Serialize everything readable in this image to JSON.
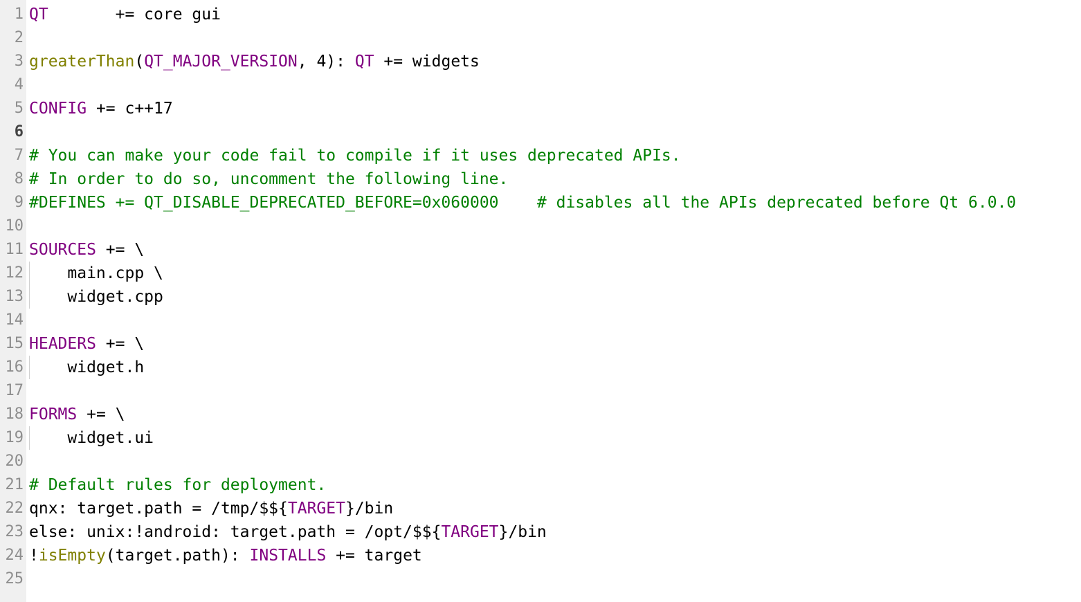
{
  "colors": {
    "variable": "#800080",
    "function": "#808000",
    "comment": "#008000",
    "plain": "#000000",
    "gutter_bg": "#f0f0f0",
    "line_number": "#8e8e8e"
  },
  "current_line": 6,
  "lines": [
    {
      "n": "1",
      "tokens": [
        {
          "t": "var",
          "v": "QT"
        },
        {
          "t": "plain",
          "v": "       += core gui"
        }
      ]
    },
    {
      "n": "2",
      "tokens": []
    },
    {
      "n": "3",
      "tokens": [
        {
          "t": "fn",
          "v": "greaterThan"
        },
        {
          "t": "plain",
          "v": "("
        },
        {
          "t": "var",
          "v": "QT_MAJOR_VERSION"
        },
        {
          "t": "plain",
          "v": ", 4): "
        },
        {
          "t": "var",
          "v": "QT"
        },
        {
          "t": "plain",
          "v": " += widgets"
        }
      ]
    },
    {
      "n": "4",
      "tokens": []
    },
    {
      "n": "5",
      "tokens": [
        {
          "t": "var",
          "v": "CONFIG"
        },
        {
          "t": "plain",
          "v": " += c++17"
        }
      ]
    },
    {
      "n": "6",
      "tokens": []
    },
    {
      "n": "7",
      "tokens": [
        {
          "t": "cmt",
          "v": "# You can make your code fail to compile if it uses deprecated APIs."
        }
      ]
    },
    {
      "n": "8",
      "tokens": [
        {
          "t": "cmt",
          "v": "# In order to do so, uncomment the following line."
        }
      ]
    },
    {
      "n": "9",
      "tokens": [
        {
          "t": "cmt",
          "v": "#DEFINES += QT_DISABLE_DEPRECATED_BEFORE=0x060000    # disables all the APIs deprecated before Qt 6.0.0"
        }
      ]
    },
    {
      "n": "10",
      "tokens": []
    },
    {
      "n": "11",
      "tokens": [
        {
          "t": "var",
          "v": "SOURCES"
        },
        {
          "t": "plain",
          "v": " += \\"
        }
      ]
    },
    {
      "n": "12",
      "indent": true,
      "tokens": [
        {
          "t": "plain",
          "v": "    main.cpp \\"
        }
      ]
    },
    {
      "n": "13",
      "indent": true,
      "tokens": [
        {
          "t": "plain",
          "v": "    widget.cpp"
        }
      ]
    },
    {
      "n": "14",
      "tokens": []
    },
    {
      "n": "15",
      "tokens": [
        {
          "t": "var",
          "v": "HEADERS"
        },
        {
          "t": "plain",
          "v": " += \\"
        }
      ]
    },
    {
      "n": "16",
      "indent": true,
      "tokens": [
        {
          "t": "plain",
          "v": "    widget.h"
        }
      ]
    },
    {
      "n": "17",
      "tokens": []
    },
    {
      "n": "18",
      "tokens": [
        {
          "t": "var",
          "v": "FORMS"
        },
        {
          "t": "plain",
          "v": " += \\"
        }
      ]
    },
    {
      "n": "19",
      "indent": true,
      "tokens": [
        {
          "t": "plain",
          "v": "    widget.ui"
        }
      ]
    },
    {
      "n": "20",
      "tokens": []
    },
    {
      "n": "21",
      "tokens": [
        {
          "t": "cmt",
          "v": "# Default rules for deployment."
        }
      ]
    },
    {
      "n": "22",
      "tokens": [
        {
          "t": "plain",
          "v": "qnx: target.path = /tmp/$${"
        },
        {
          "t": "var",
          "v": "TARGET"
        },
        {
          "t": "plain",
          "v": "}/bin"
        }
      ]
    },
    {
      "n": "23",
      "tokens": [
        {
          "t": "plain",
          "v": "else: unix:!android: target.path = /opt/$${"
        },
        {
          "t": "var",
          "v": "TARGET"
        },
        {
          "t": "plain",
          "v": "}/bin"
        }
      ]
    },
    {
      "n": "24",
      "tokens": [
        {
          "t": "plain",
          "v": "!"
        },
        {
          "t": "fn",
          "v": "isEmpty"
        },
        {
          "t": "plain",
          "v": "(target.path): "
        },
        {
          "t": "var",
          "v": "INSTALLS"
        },
        {
          "t": "plain",
          "v": " += target"
        }
      ]
    },
    {
      "n": "25",
      "tokens": []
    }
  ]
}
